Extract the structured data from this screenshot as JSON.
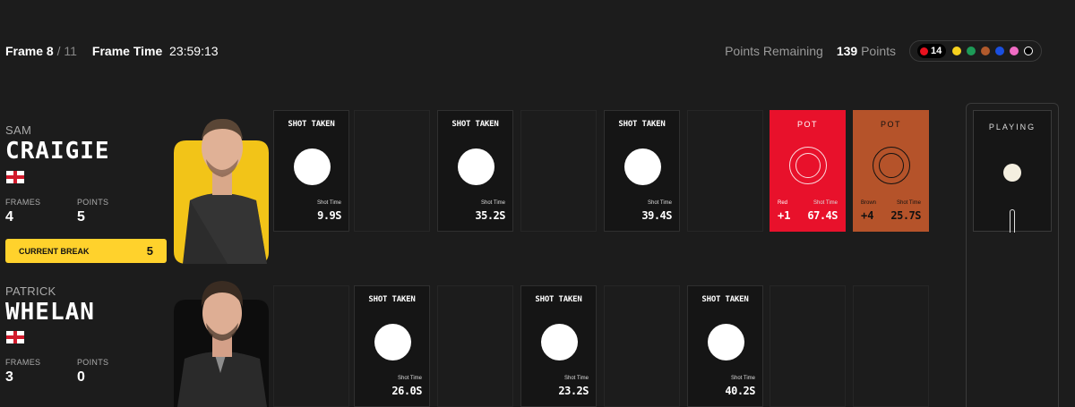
{
  "header": {
    "frame_label": "Frame",
    "frame_current": "8",
    "frame_sep_total": "/ 11",
    "frame_time_label": "Frame Time",
    "frame_time": "23:59:13",
    "points_remaining_label": "Points Remaining",
    "points_remaining_value": "139",
    "points_unit": "Points",
    "reds_remaining": "14",
    "colour_balls": [
      {
        "name": "yellow",
        "color": "#f7d21e"
      },
      {
        "name": "green",
        "color": "#1d9a57"
      },
      {
        "name": "brown",
        "color": "#b05a2c"
      },
      {
        "name": "blue",
        "color": "#1a4fe0"
      },
      {
        "name": "pink",
        "color": "#f06cc4"
      },
      {
        "name": "black",
        "color": "#000000"
      }
    ]
  },
  "players": [
    {
      "first_name": "SAM",
      "last_name": "CRAIGIE",
      "country": "England",
      "frames_label": "FRAMES",
      "frames": "4",
      "points_label": "POINTS",
      "points": "5",
      "current_break_label": "CURRENT BREAK",
      "current_break": "5",
      "photo_bg": "#f2c418",
      "shots": [
        {
          "type": "shot",
          "title": "SHOT TAKEN",
          "time_label": "Shot Time",
          "time": "9.9S"
        },
        {
          "type": "empty"
        },
        {
          "type": "shot",
          "title": "SHOT TAKEN",
          "time_label": "Shot Time",
          "time": "35.2S"
        },
        {
          "type": "empty"
        },
        {
          "type": "shot",
          "title": "SHOT TAKEN",
          "time_label": "Shot Time",
          "time": "39.4S"
        },
        {
          "type": "empty"
        },
        {
          "type": "pot",
          "title": "POT",
          "ball": "Red",
          "points": "+1",
          "time_label": "Shot Time",
          "time": "67.4S",
          "color": "#e8112b"
        },
        {
          "type": "pot",
          "title": "POT",
          "ball": "Brown",
          "points": "+4",
          "time_label": "Shot Time",
          "time": "25.7S",
          "color": "#b5532a"
        }
      ]
    },
    {
      "first_name": "PATRICK",
      "last_name": "WHELAN",
      "country": "England",
      "frames_label": "FRAMES",
      "frames": "3",
      "points_label": "POINTS",
      "points": "0",
      "photo_bg": "#0d0d0d",
      "shots": [
        {
          "type": "empty"
        },
        {
          "type": "shot",
          "title": "SHOT TAKEN",
          "time_label": "Shot Time",
          "time": "26.0S"
        },
        {
          "type": "empty"
        },
        {
          "type": "shot",
          "title": "SHOT TAKEN",
          "time_label": "Shot Time",
          "time": "23.2S"
        },
        {
          "type": "empty"
        },
        {
          "type": "shot",
          "title": "SHOT TAKEN",
          "time_label": "Shot Time",
          "time": "40.2S"
        },
        {
          "type": "empty"
        },
        {
          "type": "empty"
        }
      ]
    }
  ],
  "playing": {
    "label": "PLAYING"
  }
}
